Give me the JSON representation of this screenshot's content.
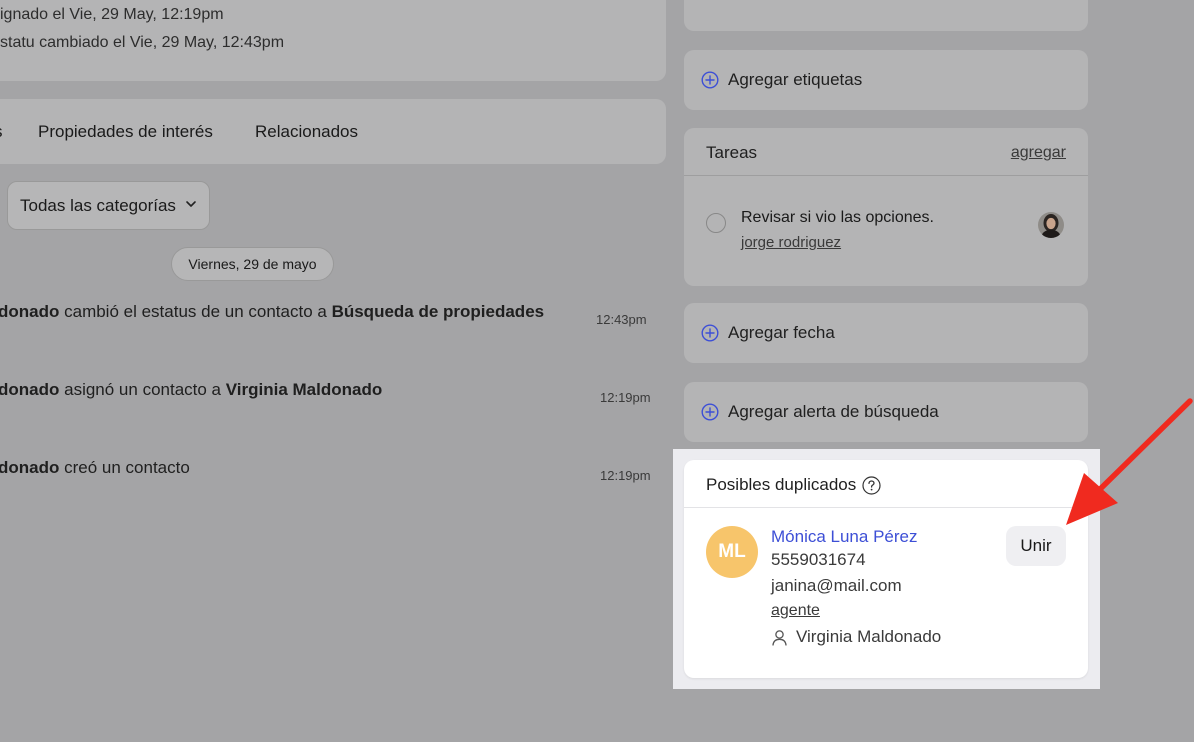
{
  "history": {
    "line1": "ignado el Vie, 29 May, 12:19pm",
    "line2": "statu cambiado el Vie, 29 May, 12:43pm"
  },
  "tabs": [
    {
      "label": "s"
    },
    {
      "label": "Propiedades de interés"
    },
    {
      "label": "Relacionados"
    }
  ],
  "filter": {
    "category_label": "Todas las categorías"
  },
  "timeline": {
    "date_label": "Viernes, 29 de mayo",
    "items": [
      {
        "actor": "donado",
        "action": " cambió el estatus de un contacto a ",
        "target": "Búsqueda de propiedades",
        "time": "12:43pm"
      },
      {
        "actor": "donado",
        "action": " asignó un contacto a ",
        "target": "Virginia Maldonado",
        "time": "12:19pm"
      },
      {
        "actor": "donado",
        "action": " creó un contacto",
        "target": "",
        "time": "12:19pm"
      }
    ]
  },
  "sidebar": {
    "add_tags": "Agregar etiquetas",
    "tasks": {
      "title": "Tareas",
      "add_label": "agregar",
      "items": [
        {
          "text": "Revisar si vio las opciones.",
          "assignee": "jorge rodriguez"
        }
      ]
    },
    "add_date": "Agregar fecha",
    "add_search_alert": "Agregar alerta de búsqueda"
  },
  "duplicates": {
    "title": "Posibles duplicados",
    "contact": {
      "initials": "ML",
      "name": "Mónica Luna Pérez",
      "phone": "5559031674",
      "email": "janina@mail.com",
      "role": "agente",
      "agent": "Virginia Maldonado"
    },
    "merge_label": "Unir"
  },
  "colors": {
    "accent": "#3d4fd6",
    "avatar": "#f7c56b",
    "arrow": "#f02a1f"
  }
}
